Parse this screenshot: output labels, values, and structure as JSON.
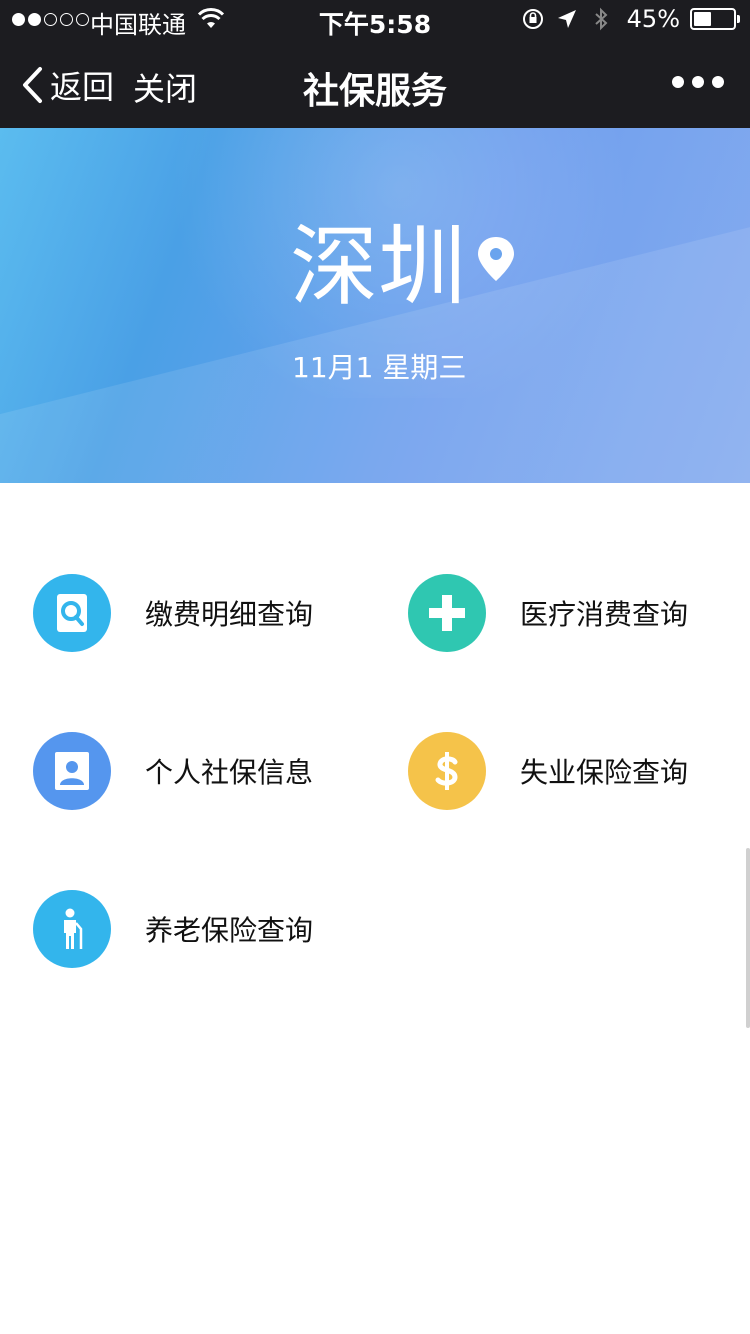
{
  "status_bar": {
    "carrier": "中国联通",
    "time": "下午5:58",
    "battery_pct": "45%",
    "battery_level": 0.45
  },
  "nav": {
    "back_label": "返回",
    "close_label": "关闭",
    "title": "社保服务"
  },
  "banner": {
    "city": "深圳",
    "date": "11月1  星期三"
  },
  "menu": {
    "items": [
      {
        "label": "缴费明细查询",
        "icon": "search-document-icon",
        "color": "#33b5ec"
      },
      {
        "label": "医疗消费查询",
        "icon": "medical-cross-icon",
        "color": "#2fc7b1"
      },
      {
        "label": "个人社保信息",
        "icon": "person-card-icon",
        "color": "#5596ee"
      },
      {
        "label": "失业保险查询",
        "icon": "dollar-icon",
        "color": "#f5c34a"
      },
      {
        "label": "养老保险查询",
        "icon": "elder-cane-icon",
        "color": "#33b5ec"
      }
    ]
  }
}
